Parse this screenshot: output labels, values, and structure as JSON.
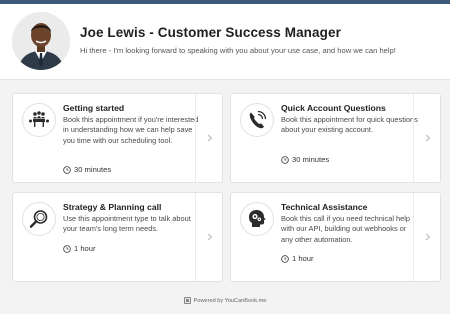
{
  "header": {
    "title": "Joe Lewis - Customer Success Manager",
    "subtitle": "Hi there - I'm looking forward to speaking with you about your use case, and how we can help!",
    "avatar_icon": "person-photo"
  },
  "cards": [
    {
      "title": "Getting started",
      "description": "Book this appointment if you're interested in understanding how we can help save you time with our scheduling tool.",
      "duration": "30 minutes",
      "icon": "meeting-table-icon"
    },
    {
      "title": "Quick Account Questions",
      "description": "Book this appointment for quick questions about your existing account.",
      "duration": "30 minutes",
      "icon": "phone-icon"
    },
    {
      "title": "Strategy & Planning call",
      "description": "Use this appointment type to talk about your team's long term needs.",
      "duration": "1 hour",
      "icon": "magnifying-glass-icon"
    },
    {
      "title": "Technical Assistance",
      "description": "Book this call if you need technical help with our API, building out webhooks or any other automation.",
      "duration": "1 hour",
      "icon": "gears-head-icon"
    }
  ],
  "footer": {
    "text": "Powered by YouCanBook.me"
  },
  "colors": {
    "accent_bar": "#3d5a78",
    "background": "#f3f3f4",
    "card": "#ffffff"
  }
}
